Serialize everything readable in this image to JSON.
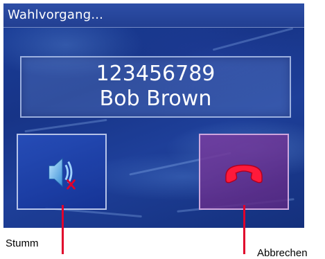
{
  "window": {
    "title": "Wahlvorgang..."
  },
  "call": {
    "number": "123456789",
    "name": "Bob Brown"
  },
  "buttons": {
    "mute": {
      "caption": "Stumm",
      "icon": "speaker-muted-icon"
    },
    "cancel": {
      "caption": "Abbrechen",
      "icon": "hang-up-icon"
    }
  },
  "colors": {
    "accent_red": "#e0002b"
  }
}
